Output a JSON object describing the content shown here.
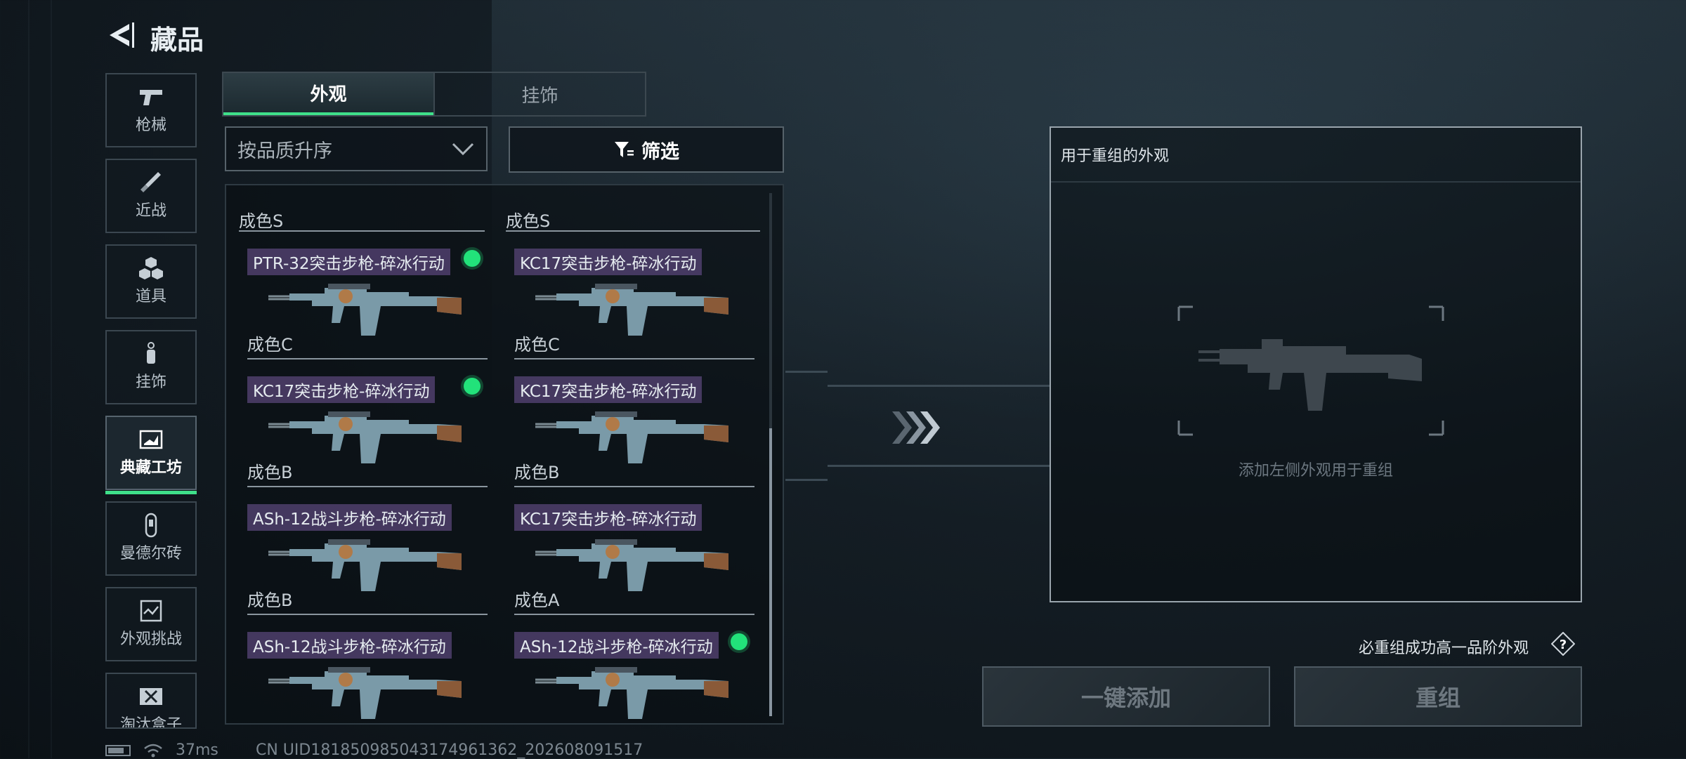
{
  "header": {
    "title": "藏品"
  },
  "nav": {
    "items": [
      {
        "label": "枪械",
        "icon": "pistol-icon"
      },
      {
        "label": "近战",
        "icon": "knife-icon"
      },
      {
        "label": "道具",
        "icon": "gear-cubes-icon"
      },
      {
        "label": "挂饰",
        "icon": "charm-icon"
      },
      {
        "label": "典藏工坊",
        "icon": "workshop-icon",
        "active": true
      },
      {
        "label": "曼德尔砖",
        "icon": "mandel-brick-icon"
      },
      {
        "label": "外观挑战",
        "icon": "challenge-icon"
      },
      {
        "label": "淘汰盒子",
        "icon": "elimination-box-icon"
      }
    ]
  },
  "tabs": [
    {
      "label": "外观",
      "active": true
    },
    {
      "label": "挂饰"
    }
  ],
  "sort": {
    "label": "按品质升序"
  },
  "filter": {
    "label": "筛选"
  },
  "grid": {
    "top_conditions": [
      "成色S",
      "成色S"
    ],
    "cards": [
      {
        "name": "PTR-32突击步枪-碎冰行动",
        "condition": "成色C",
        "selected": true
      },
      {
        "name": "KC17突击步枪-碎冰行动",
        "condition": "成色C",
        "selected": false
      },
      {
        "name": "KC17突击步枪-碎冰行动",
        "condition": "成色B",
        "selected": true
      },
      {
        "name": "KC17突击步枪-碎冰行动",
        "condition": "成色B",
        "selected": false
      },
      {
        "name": "ASh-12战斗步枪-碎冰行动",
        "condition": "成色B",
        "selected": false
      },
      {
        "name": "KC17突击步枪-碎冰行动",
        "condition": "成色A",
        "selected": false
      },
      {
        "name": "ASh-12战斗步枪-碎冰行动",
        "condition": "",
        "selected": false
      },
      {
        "name": "ASh-12战斗步枪-碎冰行动",
        "condition": "",
        "selected": true
      }
    ]
  },
  "panel": {
    "title": "用于重组的外观",
    "hint": "添加左侧外观用于重组"
  },
  "guarantee": "必重组成功高一品阶外观",
  "buttons": {
    "add": "一键添加",
    "recombine": "重组"
  },
  "status": {
    "ping": "37ms",
    "uid": "CN UID1818509850431749613​62_202608091517"
  },
  "colors": {
    "accent": "#3fe08a",
    "selected_dot": "#22e27a",
    "name_tag": "#584678"
  }
}
